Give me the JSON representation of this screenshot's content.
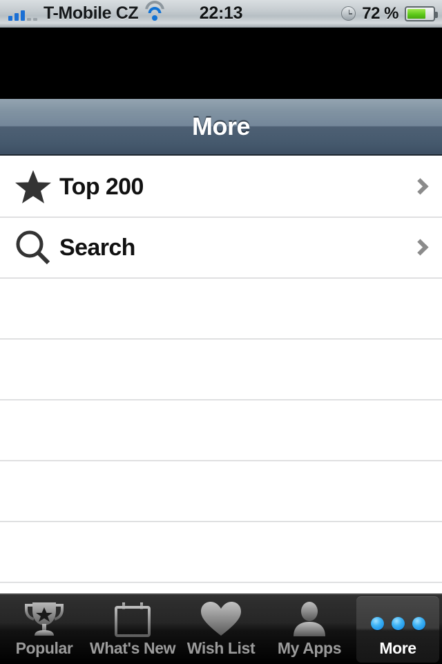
{
  "status_bar": {
    "carrier": "T-Mobile CZ",
    "signal_bars_filled": 3,
    "signal_bars_empty": 2,
    "wifi_icon": "wifi-icon",
    "time": "22:13",
    "clock_icon": "clock-icon",
    "battery_percent_label": "72 %",
    "battery_level": 72,
    "battery_color": "#5ec91a"
  },
  "navbar": {
    "title": "More"
  },
  "list": {
    "rows": [
      {
        "icon": "star-icon",
        "label": "Top 200",
        "accessory": "chevron-right-icon"
      },
      {
        "icon": "search-icon",
        "label": "Search",
        "accessory": "chevron-right-icon"
      }
    ],
    "empty_row_count": 5,
    "separator_color": "#dfe0e1"
  },
  "tabbar": {
    "tabs": [
      {
        "id": "popular",
        "label": "Popular",
        "icon": "trophy-icon",
        "active": false
      },
      {
        "id": "whats-new",
        "label": "What's New",
        "icon": "calendar-icon",
        "active": false
      },
      {
        "id": "wish-list",
        "label": "Wish List",
        "icon": "heart-icon",
        "active": false
      },
      {
        "id": "my-apps",
        "label": "My Apps",
        "icon": "person-icon",
        "active": false
      },
      {
        "id": "more",
        "label": "More",
        "icon": "three-dots-icon",
        "active": true
      }
    ],
    "active_tab": "more",
    "accent_color": "#3eb3f5"
  }
}
